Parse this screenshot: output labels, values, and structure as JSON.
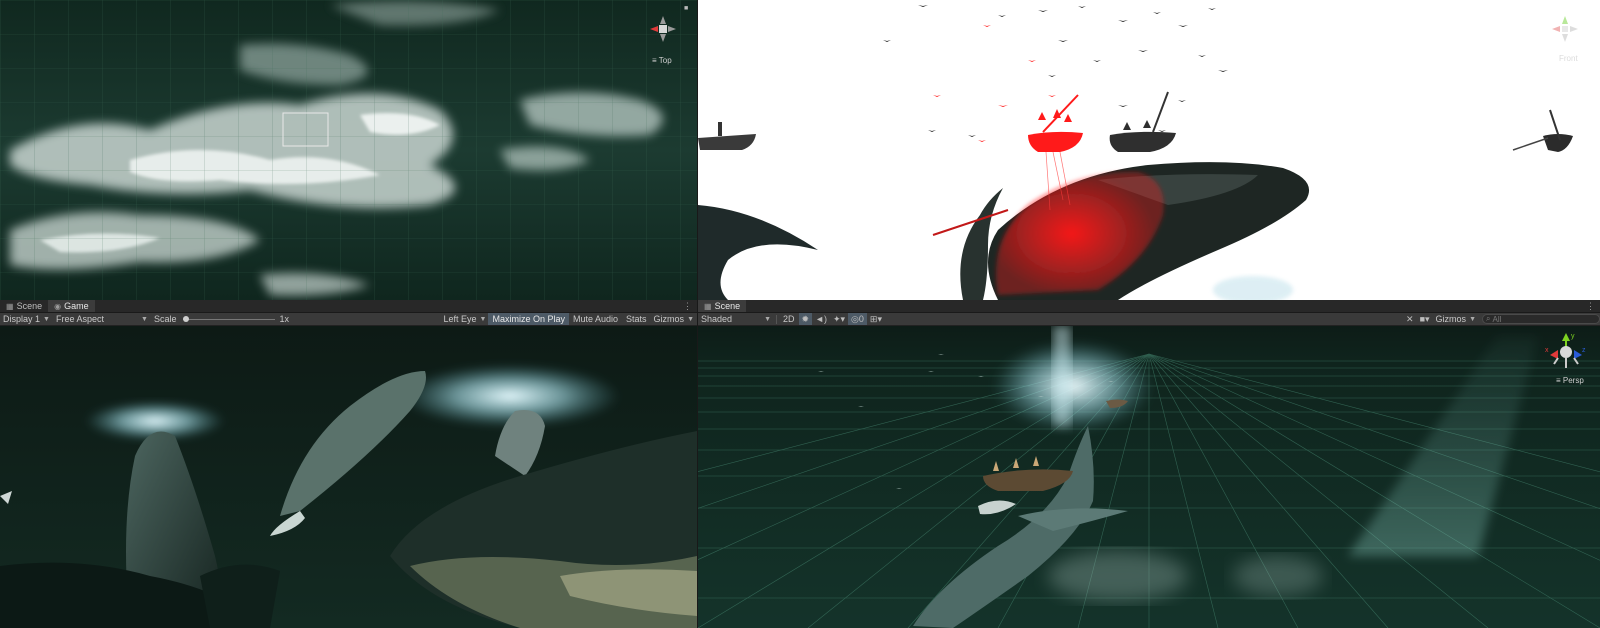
{
  "top_left": {
    "gizmo_label": "Top"
  },
  "top_right": {
    "gizmo_label": "Front"
  },
  "game_panel": {
    "tabs": [
      {
        "label": "Scene",
        "icon": "grid-icon",
        "active": false
      },
      {
        "label": "Game",
        "icon": "gamepad-icon",
        "active": true
      }
    ],
    "display": "Display 1",
    "aspect": "Free Aspect",
    "scale_label": "Scale",
    "scale_value": "1x",
    "eye": "Left Eye",
    "maximize_label": "Maximize On Play",
    "mute_label": "Mute Audio",
    "stats_label": "Stats",
    "gizmos_label": "Gizmos"
  },
  "scene_panel": {
    "tab_label": "Scene",
    "shading": "Shaded",
    "mode_2d": "2D",
    "hidden_count": "0",
    "gizmos_label": "Gizmos",
    "search_placeholder": "All",
    "persp_label": "Persp",
    "axis_y_label": "y",
    "axis_x_label": "x",
    "axis_z_label": "z"
  },
  "colors": {
    "editor_bg": "#282828",
    "toolbar_bg": "#3a3a3a",
    "active_tab": "#3c3c3c",
    "axis_x": "#e03a3a",
    "axis_y": "#7ed321",
    "axis_z": "#2a5bd7",
    "selection_red": "#ff1a1a"
  }
}
